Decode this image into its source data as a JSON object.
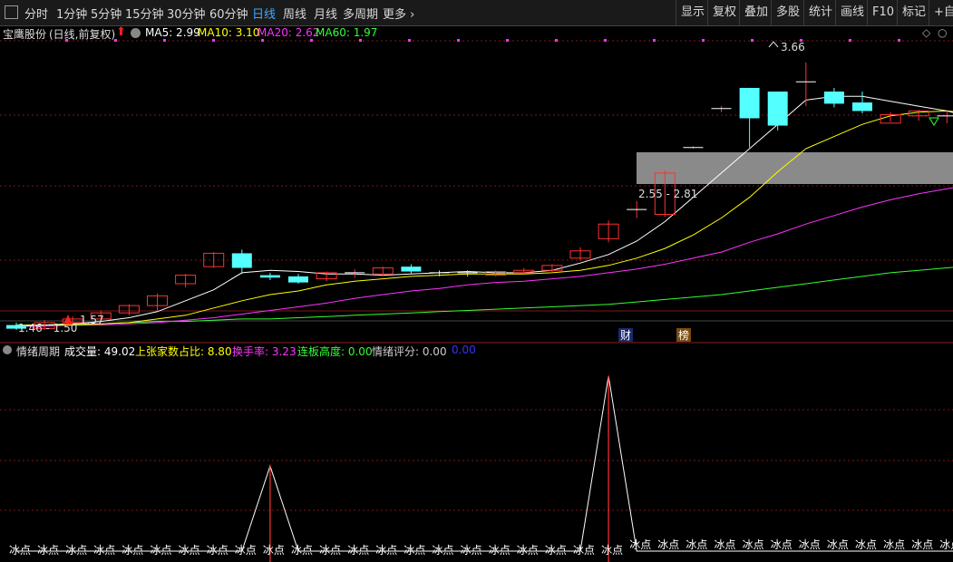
{
  "toolbar": {
    "tabs": [
      {
        "label": "分时"
      },
      {
        "label": "1分钟"
      },
      {
        "label": "5分钟"
      },
      {
        "label": "15分钟"
      },
      {
        "label": "30分钟"
      },
      {
        "label": "60分钟"
      },
      {
        "label": "日线"
      },
      {
        "label": "周线"
      },
      {
        "label": "月线"
      },
      {
        "label": "多周期"
      },
      {
        "label": "更多"
      }
    ],
    "active_tab": "日线",
    "right_buttons": [
      {
        "label": "显示"
      },
      {
        "label": "复权"
      },
      {
        "label": "叠加"
      },
      {
        "label": "多股"
      },
      {
        "label": "统计"
      },
      {
        "label": "画线"
      },
      {
        "label": "F10"
      },
      {
        "label": "标记"
      },
      {
        "label": "+自选"
      }
    ]
  },
  "main_header": {
    "stock_name": "宝鹰股份",
    "period_note": "(日线,前复权)",
    "ma5": "MA5: 2.99",
    "ma10": "MA10: 3.10",
    "ma20": "MA20: 2.62",
    "ma60": "MA60: 1.97",
    "colors": {
      "ma5": "#ffffff",
      "ma10": "#ffff00",
      "ma20": "#ff33ff",
      "ma60": "#33ff33"
    }
  },
  "price_annotations": {
    "high_label": "3.66",
    "range_label": "2.55 - 2.81",
    "low_label_a": "1.46 - 1.50",
    "low_label_b": "1.57"
  },
  "markers": {
    "cai": "财",
    "bang": "榜"
  },
  "indicator_header": {
    "name": "情绪周期",
    "volume": "成交量: 49.02",
    "rise_ratio": "上张家数占比: 8.80",
    "turnover": "换手率: 3.23",
    "limit_height": "连板高度: 0.00",
    "score": "情绪评分: 0.00",
    "extra": "0.00",
    "colors": {
      "volume": "#ffffff",
      "rise_ratio": "#ffff00",
      "turnover": "#ff33ff",
      "limit_height": "#33ff33",
      "score": "#cccccc",
      "extra": "#3333ff"
    }
  },
  "ice_label": "冰点",
  "chart_data": {
    "type": "candlestick",
    "candles": [
      {
        "o": 1.5,
        "c": 1.47,
        "h": 1.52,
        "l": 1.46
      },
      {
        "o": 1.47,
        "c": 1.52,
        "h": 1.54,
        "l": 1.46
      },
      {
        "o": 1.52,
        "c": 1.55,
        "h": 1.57,
        "l": 1.5
      },
      {
        "o": 1.55,
        "c": 1.6,
        "h": 1.62,
        "l": 1.53
      },
      {
        "o": 1.6,
        "c": 1.66,
        "h": 1.67,
        "l": 1.58
      },
      {
        "o": 1.66,
        "c": 1.74,
        "h": 1.76,
        "l": 1.62
      },
      {
        "o": 1.84,
        "c": 1.91,
        "h": 1.92,
        "l": 1.81
      },
      {
        "o": 1.98,
        "c": 2.09,
        "h": 2.1,
        "l": 1.97
      },
      {
        "o": 2.09,
        "c": 1.97,
        "h": 2.12,
        "l": 1.92
      },
      {
        "o": 1.91,
        "c": 1.89,
        "h": 1.93,
        "l": 1.87
      },
      {
        "o": 1.9,
        "c": 1.85,
        "h": 1.92,
        "l": 1.84
      },
      {
        "o": 1.88,
        "c": 1.93,
        "h": 1.94,
        "l": 1.86
      },
      {
        "o": 1.92,
        "c": 1.93,
        "h": 1.96,
        "l": 1.89
      },
      {
        "o": 1.92,
        "c": 1.97,
        "h": 1.98,
        "l": 1.9
      },
      {
        "o": 1.98,
        "c": 1.94,
        "h": 2.0,
        "l": 1.92
      },
      {
        "o": 1.93,
        "c": 1.92,
        "h": 1.95,
        "l": 1.9
      },
      {
        "o": 1.93,
        "c": 1.92,
        "h": 1.95,
        "l": 1.9
      },
      {
        "o": 1.91,
        "c": 1.94,
        "h": 1.95,
        "l": 1.9
      },
      {
        "o": 1.93,
        "c": 1.95,
        "h": 1.97,
        "l": 1.92
      },
      {
        "o": 1.95,
        "c": 1.99,
        "h": 2.0,
        "l": 1.93
      },
      {
        "o": 2.05,
        "c": 2.11,
        "h": 2.14,
        "l": 2.03
      },
      {
        "o": 2.21,
        "c": 2.33,
        "h": 2.36,
        "l": 2.18
      },
      {
        "o": 2.45,
        "c": 2.45,
        "h": 2.52,
        "l": 2.38
      },
      {
        "o": 2.41,
        "c": 2.75,
        "h": 2.77,
        "l": 2.39
      },
      {
        "o": 2.96,
        "c": 2.96,
        "h": 2.97,
        "l": 2.95
      },
      {
        "o": 3.28,
        "c": 3.28,
        "h": 3.3,
        "l": 3.25
      },
      {
        "o": 3.45,
        "c": 3.2,
        "h": 3.45,
        "l": 2.96
      },
      {
        "o": 3.42,
        "c": 3.14,
        "h": 3.42,
        "l": 3.1
      },
      {
        "o": 3.5,
        "c": 3.5,
        "h": 3.66,
        "l": 3.3
      },
      {
        "o": 3.42,
        "c": 3.32,
        "h": 3.45,
        "l": 3.29
      },
      {
        "o": 3.33,
        "c": 3.26,
        "h": 3.42,
        "l": 3.24
      },
      {
        "o": 3.16,
        "c": 3.23,
        "h": 3.25,
        "l": 3.17
      },
      {
        "o": 3.22,
        "c": 3.26,
        "h": 3.27,
        "l": 3.18
      },
      {
        "o": 3.22,
        "c": 3.22,
        "h": 3.26,
        "l": 3.16
      },
      {
        "o": 3.17,
        "c": 3.05,
        "h": 3.19,
        "l": 3.05
      }
    ],
    "ma5": [
      1.49,
      1.5,
      1.51,
      1.53,
      1.56,
      1.61,
      1.7,
      1.79,
      1.93,
      1.95,
      1.94,
      1.92,
      1.92,
      1.91,
      1.92,
      1.93,
      1.94,
      1.93,
      1.93,
      1.95,
      2.01,
      2.08,
      2.19,
      2.35,
      2.55,
      2.75,
      2.95,
      3.15,
      3.35,
      3.38,
      3.38,
      3.34,
      3.3,
      3.26,
      3.2
    ],
    "ma10": [
      1.5,
      1.5,
      1.5,
      1.51,
      1.52,
      1.55,
      1.58,
      1.64,
      1.7,
      1.75,
      1.78,
      1.83,
      1.86,
      1.88,
      1.9,
      1.91,
      1.92,
      1.92,
      1.92,
      1.93,
      1.95,
      1.99,
      2.05,
      2.13,
      2.24,
      2.38,
      2.55,
      2.76,
      2.95,
      3.05,
      3.15,
      3.22,
      3.25,
      3.26,
      3.24
    ],
    "ma20": [
      1.49,
      1.49,
      1.5,
      1.5,
      1.51,
      1.52,
      1.54,
      1.56,
      1.59,
      1.62,
      1.65,
      1.68,
      1.72,
      1.75,
      1.78,
      1.8,
      1.83,
      1.85,
      1.86,
      1.88,
      1.9,
      1.93,
      1.96,
      2.0,
      2.05,
      2.1,
      2.18,
      2.25,
      2.33,
      2.4,
      2.47,
      2.53,
      2.58,
      2.62,
      2.66
    ],
    "ma60": [
      1.5,
      1.5,
      1.51,
      1.51,
      1.52,
      1.53,
      1.53,
      1.54,
      1.55,
      1.55,
      1.56,
      1.57,
      1.58,
      1.59,
      1.6,
      1.61,
      1.62,
      1.63,
      1.64,
      1.65,
      1.66,
      1.67,
      1.69,
      1.71,
      1.73,
      1.75,
      1.78,
      1.81,
      1.84,
      1.87,
      1.9,
      1.93,
      1.95,
      1.97,
      1.99
    ],
    "indicator": [
      0,
      0,
      0,
      0,
      0,
      0,
      0,
      0,
      0,
      1.7,
      0,
      0,
      0,
      0,
      0,
      0,
      0,
      0,
      0,
      0,
      0,
      3.5,
      0,
      0,
      0,
      0,
      0,
      0,
      0,
      0,
      0,
      0,
      0,
      0,
      0
    ],
    "ylim": [
      1.4,
      3.8
    ],
    "ind_ylim": [
      0,
      3.8
    ]
  }
}
